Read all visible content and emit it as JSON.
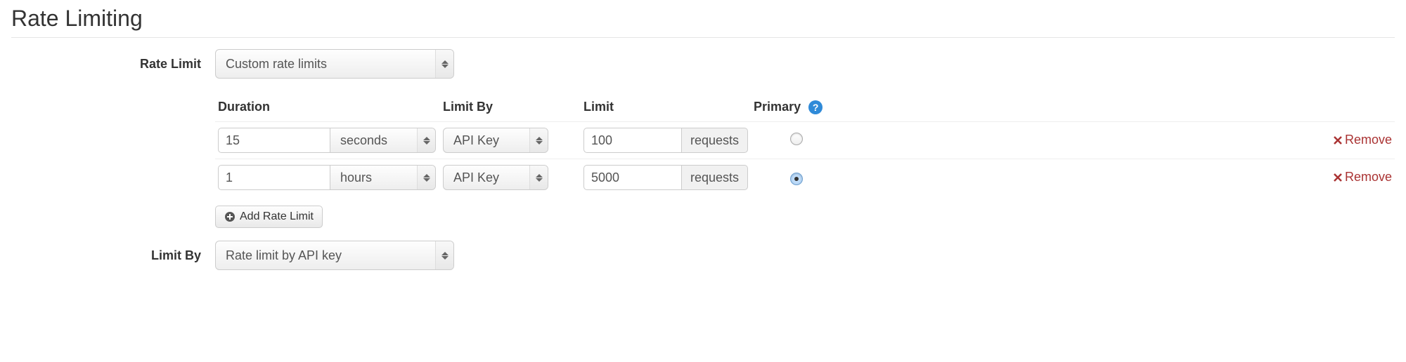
{
  "title": "Rate Limiting",
  "labels": {
    "rate_limit": "Rate Limit",
    "limit_by": "Limit By"
  },
  "rate_limit_select": "Custom rate limits",
  "limit_by_select": "Rate limit by API key",
  "columns": {
    "duration": "Duration",
    "limit_by": "Limit By",
    "limit": "Limit",
    "primary": "Primary"
  },
  "rows": [
    {
      "duration_value": "15",
      "duration_unit": "seconds",
      "limit_by": "API Key",
      "limit_value": "100",
      "limit_unit": "requests",
      "primary": false
    },
    {
      "duration_value": "1",
      "duration_unit": "hours",
      "limit_by": "API Key",
      "limit_value": "5000",
      "limit_unit": "requests",
      "primary": true
    }
  ],
  "add_button": "Add Rate Limit",
  "remove_text": "Remove",
  "help_tooltip": "?"
}
